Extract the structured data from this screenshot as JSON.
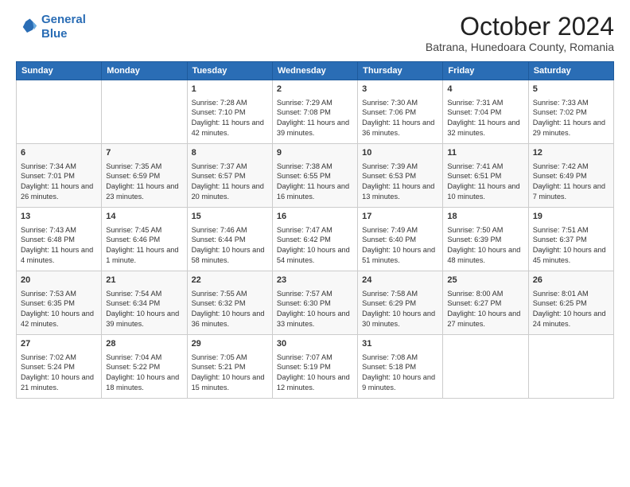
{
  "logo": {
    "line1": "General",
    "line2": "Blue"
  },
  "header": {
    "month": "October 2024",
    "location": "Batrana, Hunedoara County, Romania"
  },
  "weekdays": [
    "Sunday",
    "Monday",
    "Tuesday",
    "Wednesday",
    "Thursday",
    "Friday",
    "Saturday"
  ],
  "weeks": [
    [
      {
        "day": "",
        "data": ""
      },
      {
        "day": "",
        "data": ""
      },
      {
        "day": "1",
        "data": "Sunrise: 7:28 AM\nSunset: 7:10 PM\nDaylight: 11 hours and 42 minutes."
      },
      {
        "day": "2",
        "data": "Sunrise: 7:29 AM\nSunset: 7:08 PM\nDaylight: 11 hours and 39 minutes."
      },
      {
        "day": "3",
        "data": "Sunrise: 7:30 AM\nSunset: 7:06 PM\nDaylight: 11 hours and 36 minutes."
      },
      {
        "day": "4",
        "data": "Sunrise: 7:31 AM\nSunset: 7:04 PM\nDaylight: 11 hours and 32 minutes."
      },
      {
        "day": "5",
        "data": "Sunrise: 7:33 AM\nSunset: 7:02 PM\nDaylight: 11 hours and 29 minutes."
      }
    ],
    [
      {
        "day": "6",
        "data": "Sunrise: 7:34 AM\nSunset: 7:01 PM\nDaylight: 11 hours and 26 minutes."
      },
      {
        "day": "7",
        "data": "Sunrise: 7:35 AM\nSunset: 6:59 PM\nDaylight: 11 hours and 23 minutes."
      },
      {
        "day": "8",
        "data": "Sunrise: 7:37 AM\nSunset: 6:57 PM\nDaylight: 11 hours and 20 minutes."
      },
      {
        "day": "9",
        "data": "Sunrise: 7:38 AM\nSunset: 6:55 PM\nDaylight: 11 hours and 16 minutes."
      },
      {
        "day": "10",
        "data": "Sunrise: 7:39 AM\nSunset: 6:53 PM\nDaylight: 11 hours and 13 minutes."
      },
      {
        "day": "11",
        "data": "Sunrise: 7:41 AM\nSunset: 6:51 PM\nDaylight: 11 hours and 10 minutes."
      },
      {
        "day": "12",
        "data": "Sunrise: 7:42 AM\nSunset: 6:49 PM\nDaylight: 11 hours and 7 minutes."
      }
    ],
    [
      {
        "day": "13",
        "data": "Sunrise: 7:43 AM\nSunset: 6:48 PM\nDaylight: 11 hours and 4 minutes."
      },
      {
        "day": "14",
        "data": "Sunrise: 7:45 AM\nSunset: 6:46 PM\nDaylight: 11 hours and 1 minute."
      },
      {
        "day": "15",
        "data": "Sunrise: 7:46 AM\nSunset: 6:44 PM\nDaylight: 10 hours and 58 minutes."
      },
      {
        "day": "16",
        "data": "Sunrise: 7:47 AM\nSunset: 6:42 PM\nDaylight: 10 hours and 54 minutes."
      },
      {
        "day": "17",
        "data": "Sunrise: 7:49 AM\nSunset: 6:40 PM\nDaylight: 10 hours and 51 minutes."
      },
      {
        "day": "18",
        "data": "Sunrise: 7:50 AM\nSunset: 6:39 PM\nDaylight: 10 hours and 48 minutes."
      },
      {
        "day": "19",
        "data": "Sunrise: 7:51 AM\nSunset: 6:37 PM\nDaylight: 10 hours and 45 minutes."
      }
    ],
    [
      {
        "day": "20",
        "data": "Sunrise: 7:53 AM\nSunset: 6:35 PM\nDaylight: 10 hours and 42 minutes."
      },
      {
        "day": "21",
        "data": "Sunrise: 7:54 AM\nSunset: 6:34 PM\nDaylight: 10 hours and 39 minutes."
      },
      {
        "day": "22",
        "data": "Sunrise: 7:55 AM\nSunset: 6:32 PM\nDaylight: 10 hours and 36 minutes."
      },
      {
        "day": "23",
        "data": "Sunrise: 7:57 AM\nSunset: 6:30 PM\nDaylight: 10 hours and 33 minutes."
      },
      {
        "day": "24",
        "data": "Sunrise: 7:58 AM\nSunset: 6:29 PM\nDaylight: 10 hours and 30 minutes."
      },
      {
        "day": "25",
        "data": "Sunrise: 8:00 AM\nSunset: 6:27 PM\nDaylight: 10 hours and 27 minutes."
      },
      {
        "day": "26",
        "data": "Sunrise: 8:01 AM\nSunset: 6:25 PM\nDaylight: 10 hours and 24 minutes."
      }
    ],
    [
      {
        "day": "27",
        "data": "Sunrise: 7:02 AM\nSunset: 5:24 PM\nDaylight: 10 hours and 21 minutes."
      },
      {
        "day": "28",
        "data": "Sunrise: 7:04 AM\nSunset: 5:22 PM\nDaylight: 10 hours and 18 minutes."
      },
      {
        "day": "29",
        "data": "Sunrise: 7:05 AM\nSunset: 5:21 PM\nDaylight: 10 hours and 15 minutes."
      },
      {
        "day": "30",
        "data": "Sunrise: 7:07 AM\nSunset: 5:19 PM\nDaylight: 10 hours and 12 minutes."
      },
      {
        "day": "31",
        "data": "Sunrise: 7:08 AM\nSunset: 5:18 PM\nDaylight: 10 hours and 9 minutes."
      },
      {
        "day": "",
        "data": ""
      },
      {
        "day": "",
        "data": ""
      }
    ]
  ]
}
